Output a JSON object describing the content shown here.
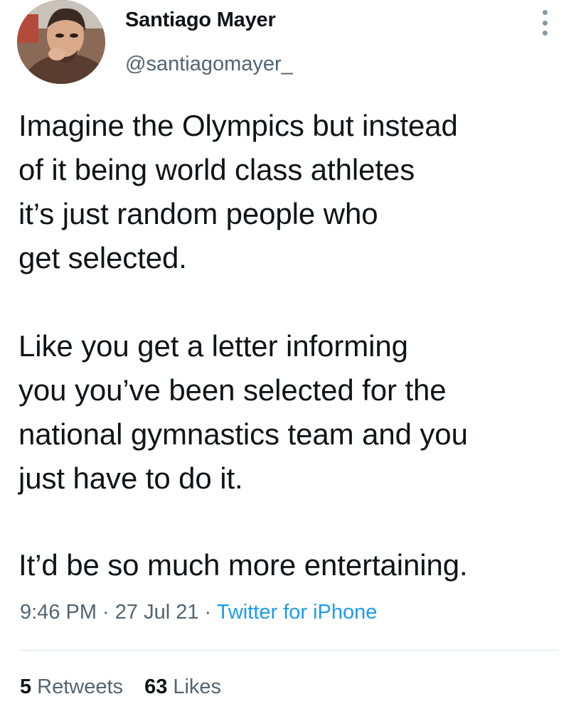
{
  "author": {
    "name": "Santiago Mayer",
    "handle": "@santiagomayer_",
    "avatar_icon": "profile-photo"
  },
  "menu": {
    "icon": "more-vertical-icon"
  },
  "tweet": {
    "paragraphs": [
      "Imagine the Olympics but instead\nof it being world class athletes\nit’s just random people who\nget selected.",
      "Like you get a letter informing\nyou you’ve been selected for the\nnational gymnastics team and you\njust have to do it.",
      "It’d be so much more entertaining."
    ]
  },
  "meta": {
    "time": "9:46 PM",
    "separator": " · ",
    "date": "27 Jul 21",
    "source": "Twitter for iPhone"
  },
  "stats": {
    "retweets_count": "5",
    "retweets_label": "Retweets",
    "likes_count": "63",
    "likes_label": "Likes"
  },
  "colors": {
    "text": "#0f1419",
    "secondary": "#536471",
    "link": "#1d9bf0",
    "divider": "#dfe5ea"
  }
}
